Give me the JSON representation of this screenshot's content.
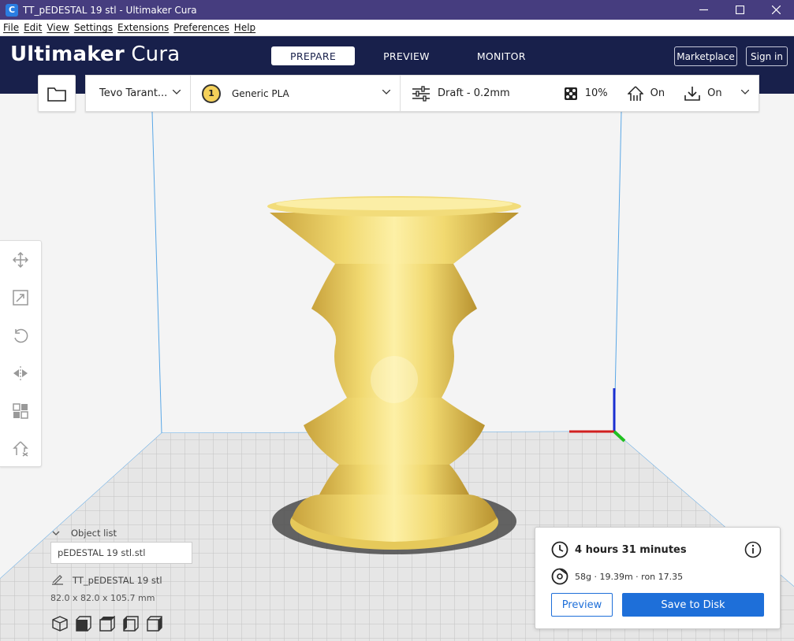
{
  "window": {
    "title": "TT_pEDESTAL 19 stl - Ultimaker Cura",
    "app_icon_letter": "C"
  },
  "menu": [
    "File",
    "Edit",
    "View",
    "Settings",
    "Extensions",
    "Preferences",
    "Help"
  ],
  "header": {
    "logo_brand": "Ultimaker",
    "logo_product": "Cura",
    "stages": [
      "PREPARE",
      "PREVIEW",
      "MONITOR"
    ],
    "active_stage": "PREPARE",
    "marketplace_label": "Marketplace",
    "signin_label": "Sign in"
  },
  "config": {
    "printer": "Tevo Tarant...",
    "extruder_number": "1",
    "material": "Generic PLA",
    "profile": "Draft - 0.2mm",
    "infill": "10%",
    "support": "On",
    "adhesion": "On"
  },
  "object_list": {
    "heading": "Object list",
    "input_value": "pEDESTAL 19 stl.stl",
    "object_name": "TT_pEDESTAL 19 stl",
    "dimensions": "82.0 x 82.0 x 105.7 mm"
  },
  "print_panel": {
    "time": "4 hours 31 minutes",
    "material_info": "58g · 19.39m · ron 17.35",
    "preview_label": "Preview",
    "save_label": "Save to Disk"
  },
  "colors": {
    "titlebar": "#463d7f",
    "header": "#18204b",
    "accent": "#1e6fd9",
    "model": "#f5e27a",
    "extruder_badge": "#f5d15a"
  },
  "icons": {
    "tools": [
      "move-icon",
      "scale-icon",
      "rotate-icon",
      "mirror-icon",
      "per-model-settings-icon",
      "support-blocker-icon"
    ],
    "views": [
      "view-3d-icon",
      "view-front-icon",
      "view-top-icon",
      "view-left-icon",
      "view-right-icon"
    ]
  }
}
